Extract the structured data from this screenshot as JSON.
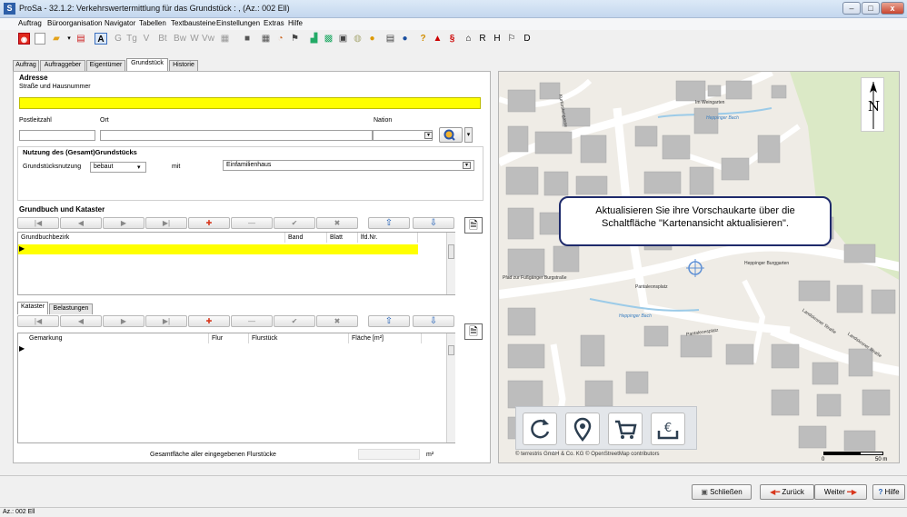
{
  "window": {
    "app_icon": "S",
    "title": "ProSa - 32.1.2: Verkehrswertermittlung für das Grundstück : ,  (Az.: 002 Ell)",
    "min": "–",
    "max": "□",
    "close": "x"
  },
  "menu": [
    "Auftrag",
    "Büroorganisation",
    "Navigator",
    "Tabellen",
    "Textbausteine",
    "Einstellungen",
    "Extras",
    "Hilfe"
  ],
  "toolbar": {
    "letter_buttons": [
      "G",
      "Tg",
      "V",
      "Bt",
      "Bw",
      "W",
      "Vw"
    ],
    "right_letters": [
      "R",
      "H",
      "D"
    ]
  },
  "tabs": [
    "Auftrag",
    "Auftraggeber",
    "Eigentümer",
    "Grundstück",
    "Historie"
  ],
  "active_tab": "Grundstück",
  "address": {
    "section": "Adresse",
    "street_label": "Straße und Hausnummer",
    "plz_label": "Postleitzahl",
    "ort_label": "Ort",
    "nation_label": "Nation"
  },
  "usage": {
    "section": "Nutzung des (Gesamt)Grundstücks",
    "label": "Grundstücksnutzung",
    "value": "bebaut",
    "mit_label": "mit",
    "type_value": "Einfamilienhaus"
  },
  "grundbuch": {
    "section": "Grundbuch und Kataster",
    "columns": [
      "Grundbuchbezirk",
      "Band",
      "Blatt",
      "lfd.Nr."
    ]
  },
  "kataster": {
    "tabs": [
      "Kataster",
      "Belastungen"
    ],
    "columns": [
      "Gemarkung",
      "Flur",
      "Flurstück",
      "Fläche [m²]"
    ],
    "total_label": "Gesamtfläche aller eingegebenen Flurstücke",
    "unit": "m²"
  },
  "nav_buttons": [
    "|◀",
    "◀",
    "▶",
    "▶|",
    "✚",
    "—",
    "✔",
    "✖",
    "⇧",
    "⇩"
  ],
  "map": {
    "north": "N",
    "notice": "Aktualisieren Sie ihre Vorschaukarte über die Schaltfläche \"Kartenansicht aktualisieren\".",
    "attribution": "© terrestris GmbH & Co. KG  © OpenStreetMap contributors",
    "scale_start": "0",
    "scale_end": "50 m",
    "street_labels": [
      "Im Weingarten",
      "Heppinger Bach",
      "Heppinger Bach",
      "Heppinger Burggarten",
      "Pantaleonsplatz",
      "Pantaleonsplatz",
      "Landskroner Straße",
      "Landskroner Straße",
      "Kurfürstengasse",
      "Pfad zur Fußgänger Burgstraße"
    ],
    "icons": [
      "refresh-icon",
      "location-pin-icon",
      "cart-icon",
      "euro-download-icon"
    ]
  },
  "actions": {
    "close": "Schließen",
    "back": "Zurück",
    "next": "Weiter",
    "help": "Hilfe"
  },
  "status": "Az.: 002 Ell",
  "colors": {
    "accent": "#ffff00",
    "callout_border": "#1e2a6b",
    "map_bg": "#efece6",
    "building": "#b8b8b8",
    "green": "#dbe9c6"
  }
}
